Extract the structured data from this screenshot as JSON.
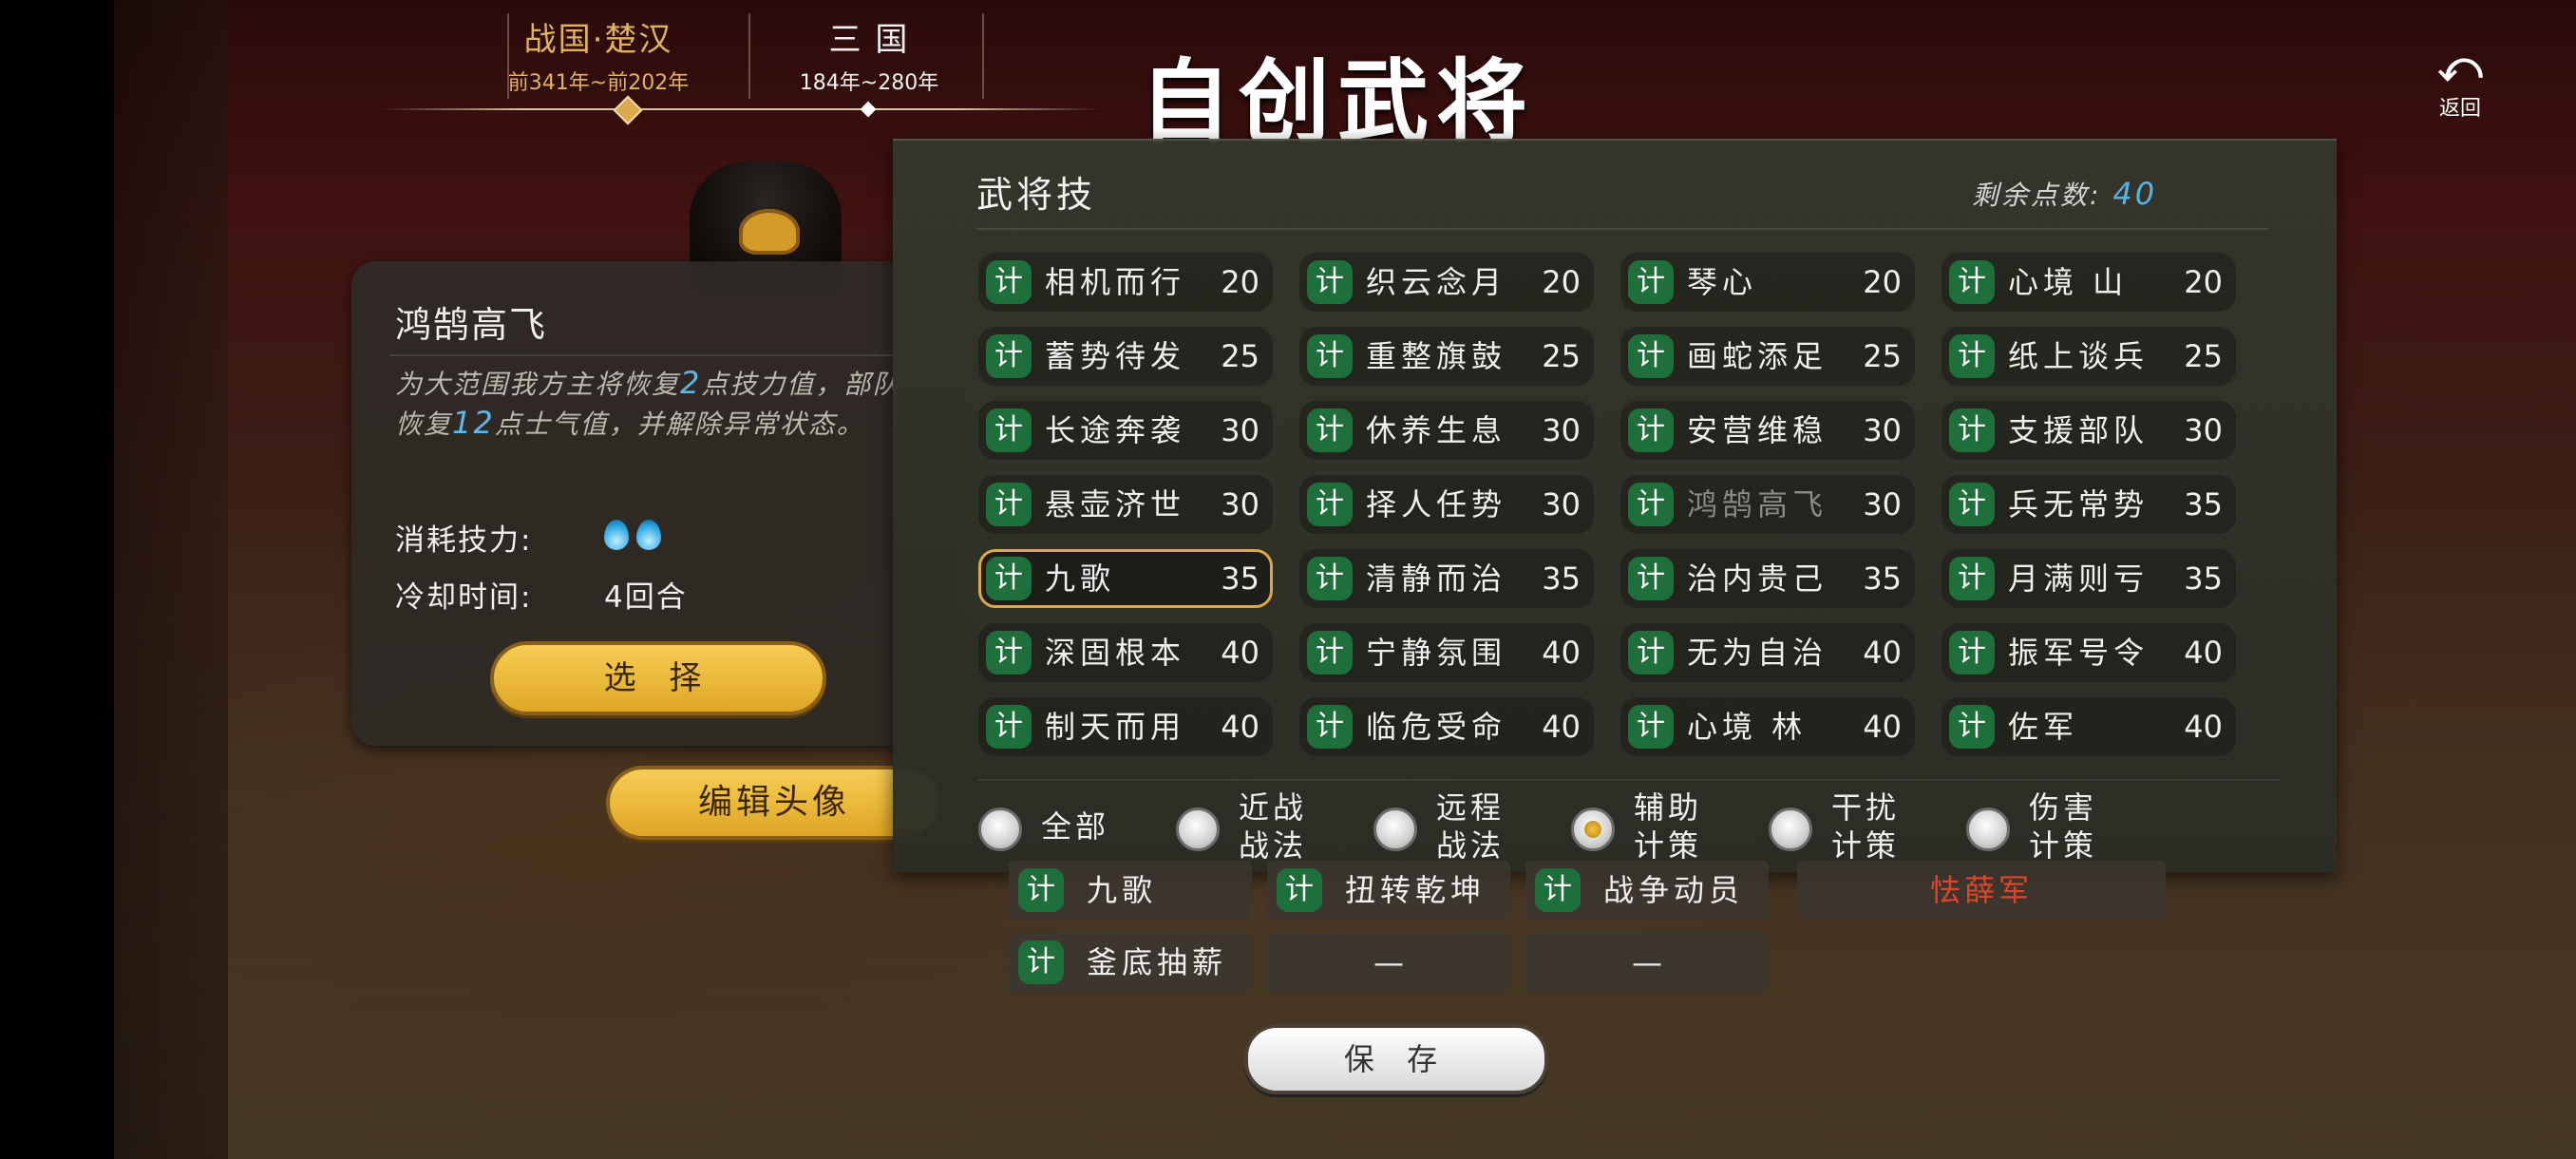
{
  "eras": [
    {
      "name": "战国·楚汉",
      "years": "前341年~前202年",
      "active": true
    },
    {
      "name": "三 国",
      "years": "184年~280年",
      "active": false
    }
  ],
  "title": "自创武将",
  "back": {
    "icon": "back-arrow-icon",
    "label": "返回"
  },
  "detail": {
    "skill_name": "鸿鹄高飞",
    "desc_parts": [
      "为大范围我方主将恢复",
      "2",
      "点技力值，部队恢复",
      "12",
      "点士气值，并解除异常状态。"
    ],
    "cost_label": "消耗技力:",
    "cost_drops": 2,
    "cooldown_label": "冷却时间:",
    "cooldown_value": "4回合",
    "select_button": "选 择"
  },
  "edit_avatar_button": "编辑头像",
  "skills_panel": {
    "heading": "武将技",
    "points_label": "剩余点数:",
    "points_value": "40",
    "tag": "计",
    "skills": [
      {
        "name": "相机而行",
        "cost": "20"
      },
      {
        "name": "织云念月",
        "cost": "20"
      },
      {
        "name": "琴心",
        "cost": "20"
      },
      {
        "name": "心境 山",
        "cost": "20"
      },
      {
        "name": "蓄势待发",
        "cost": "25"
      },
      {
        "name": "重整旗鼓",
        "cost": "25"
      },
      {
        "name": "画蛇添足",
        "cost": "25"
      },
      {
        "name": "纸上谈兵",
        "cost": "25"
      },
      {
        "name": "长途奔袭",
        "cost": "30"
      },
      {
        "name": "休养生息",
        "cost": "30"
      },
      {
        "name": "安营维稳",
        "cost": "30"
      },
      {
        "name": "支援部队",
        "cost": "30"
      },
      {
        "name": "悬壶济世",
        "cost": "30"
      },
      {
        "name": "择人任势",
        "cost": "30"
      },
      {
        "name": "鸿鹄高飞",
        "cost": "30",
        "dim": true
      },
      {
        "name": "兵无常势",
        "cost": "35"
      },
      {
        "name": "九歌",
        "cost": "35",
        "selected": true
      },
      {
        "name": "清静而治",
        "cost": "35"
      },
      {
        "name": "治内贵己",
        "cost": "35"
      },
      {
        "name": "月满则亏",
        "cost": "35"
      },
      {
        "name": "深固根本",
        "cost": "40"
      },
      {
        "name": "宁静氛围",
        "cost": "40"
      },
      {
        "name": "无为自治",
        "cost": "40"
      },
      {
        "name": "振军号令",
        "cost": "40"
      },
      {
        "name": "制天而用",
        "cost": "40"
      },
      {
        "name": "临危受命",
        "cost": "40"
      },
      {
        "name": "心境 林",
        "cost": "40"
      },
      {
        "name": "佐军",
        "cost": "40"
      }
    ],
    "filters": [
      {
        "label1": "全部",
        "label2": "",
        "checked": false
      },
      {
        "label1": "近战",
        "label2": "战法",
        "checked": false
      },
      {
        "label1": "远程",
        "label2": "战法",
        "checked": false
      },
      {
        "label1": "辅助",
        "label2": "计策",
        "checked": true
      },
      {
        "label1": "干扰",
        "label2": "计策",
        "checked": false
      },
      {
        "label1": "伤害",
        "label2": "计策",
        "checked": false
      }
    ]
  },
  "equipped": [
    {
      "type": "skill",
      "name": "九歌"
    },
    {
      "type": "skill",
      "name": "扭转乾坤"
    },
    {
      "type": "skill",
      "name": "战争动员"
    },
    {
      "type": "red",
      "name": "怯薛军"
    },
    {
      "type": "skill",
      "name": "釜底抽薪"
    },
    {
      "type": "empty",
      "name": "—"
    },
    {
      "type": "empty",
      "name": "—"
    }
  ],
  "save_button": "保 存",
  "colors": {
    "accent_gold": "#d9a94a",
    "tag_green": "#1f6f3a",
    "points_blue": "#56b3e6",
    "warning_red": "#e0452a"
  }
}
